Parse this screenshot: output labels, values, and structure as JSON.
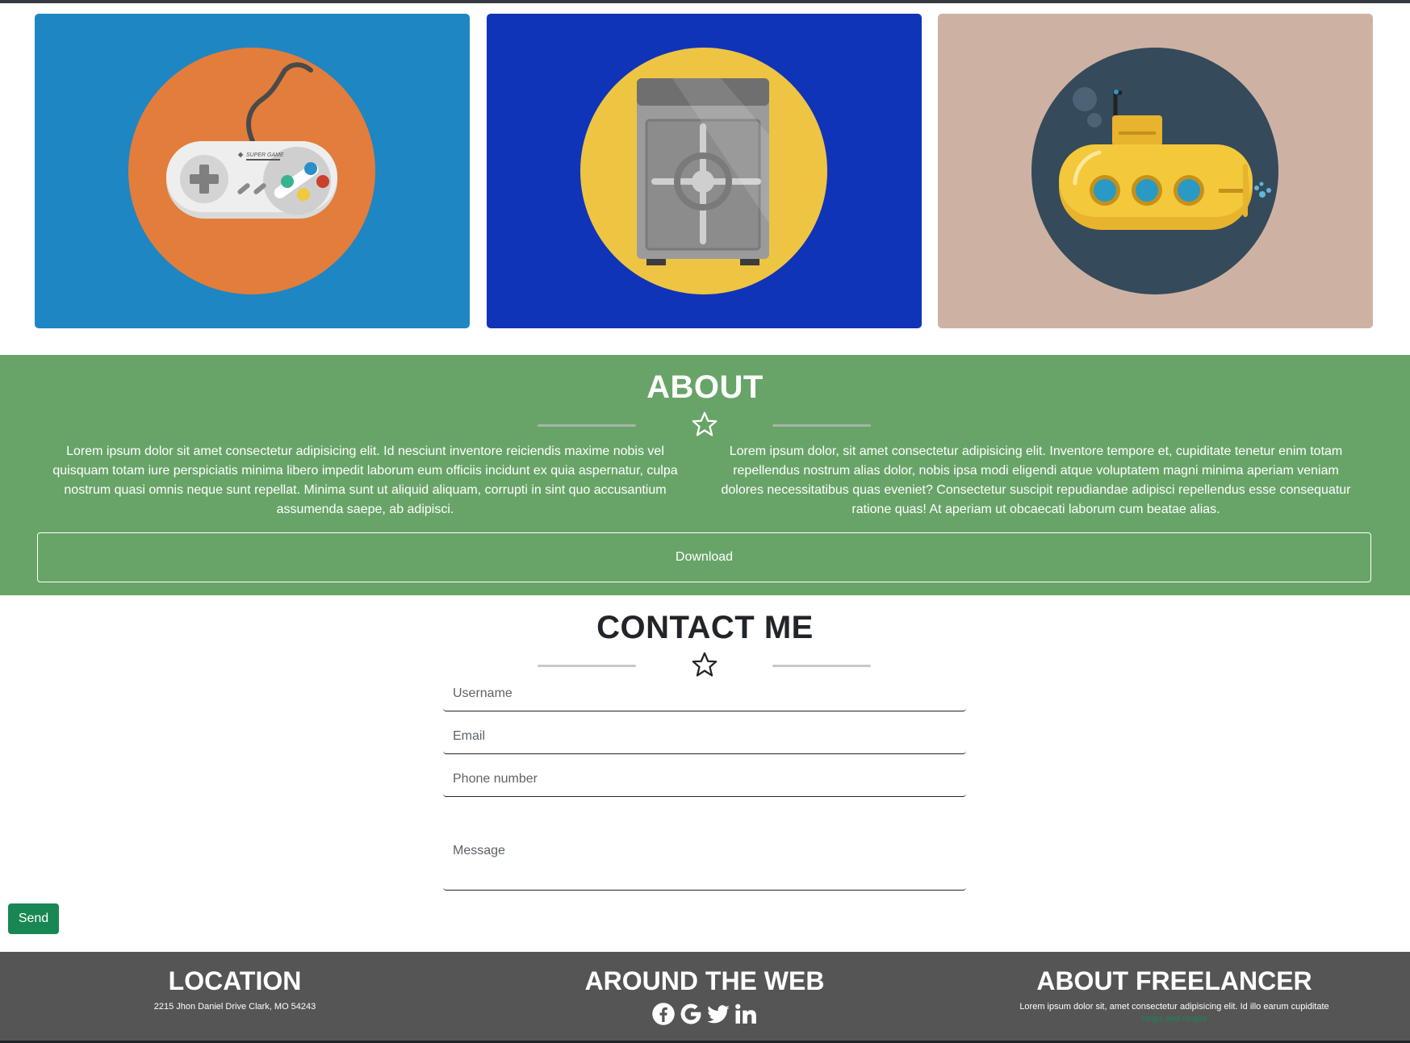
{
  "colors": {
    "topbar": "#343a40",
    "card_1_bg": "#1e86c2",
    "card_2_bg": "#1034b8",
    "card_3_bg": "#cdb2a4",
    "about_bg": "#68a468",
    "divider_line": "#a9b4a9",
    "send_button": "#198754",
    "footer_bg": "#555555",
    "footer_link": "#198754"
  },
  "portfolio": {
    "items": [
      {
        "icon": "game-controller-icon",
        "circle": "#e37d3b",
        "label": "SUPER GAME"
      },
      {
        "icon": "safe-icon",
        "circle": "#eec443"
      },
      {
        "icon": "submarine-icon",
        "circle": "#354a5b"
      }
    ]
  },
  "about": {
    "title": "ABOUT",
    "divider_icon": "star-icon",
    "left_text": "Lorem ipsum dolor sit amet consectetur adipisicing elit. Id nesciunt inventore reiciendis maxime nobis vel quisquam totam iure perspiciatis minima libero impedit laborum eum officiis incidunt ex quia aspernatur, culpa nostrum quasi omnis neque sunt repellat. Minima sunt ut aliquid aliquam, corrupti in sint quo accusantium assumenda saepe, ab adipisci.",
    "right_text": "Lorem ipsum dolor, sit amet consectetur adipisicing elit. Inventore tempore et, cupiditate tenetur enim totam repellendus nostrum alias dolor, nobis ipsa modi eligendi atque voluptatem magni minima aperiam veniam dolores necessitatibus quas eveniet? Consectetur suscipit repudiandae adipisci repellendus esse consequatur ratione quas! At aperiam ut obcaecati laborum cum beatae alias.",
    "download_label": "Download"
  },
  "contact": {
    "title": "CONTACT ME",
    "divider_icon": "star-icon",
    "username_placeholder": "Username",
    "email_placeholder": "Email",
    "phone_placeholder": "Phone number",
    "message_placeholder": "Message",
    "send_label": "Send"
  },
  "footer": {
    "location": {
      "title": "LOCATION",
      "address": "2215 Jhon Daniel Drive Clark, MO 54243"
    },
    "web": {
      "title": "AROUND THE WEB",
      "icons": [
        "facebook-icon",
        "google-icon",
        "twitter-icon",
        "linkedin-icon"
      ]
    },
    "about": {
      "title": "ABOUT FREELANCER",
      "text": "Lorem ipsum dolor sit, amet consectetur adipisicing elit. Id illo earum cupiditate",
      "link": "sequi sed neque"
    }
  }
}
